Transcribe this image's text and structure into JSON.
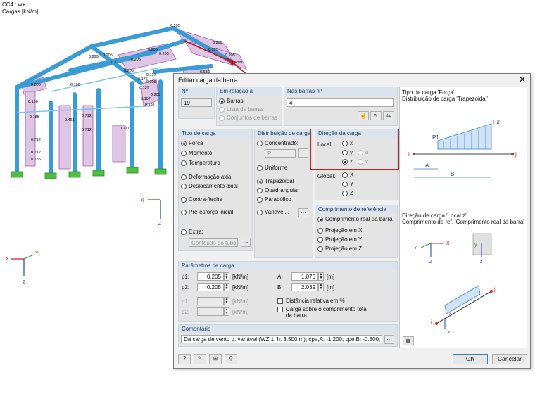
{
  "viewport": {
    "load_case": "CC4 : w+",
    "units_label": "Cargas [kN/m]",
    "load_values": [
      "0.205",
      "0.205",
      "0.205",
      "0.205",
      "0.299",
      "0.205",
      "0.205",
      "0.205",
      "0.137",
      "0.205",
      "0.137",
      "0.171",
      "0.176",
      "0.205",
      "0.107",
      "0.277",
      "0.712",
      "0.712",
      "0.185",
      "0.190",
      "0.461",
      "0.712",
      "0.712",
      "0.185",
      "0.190",
      "0.800",
      "0.299",
      "0.205",
      "0.205",
      "0.630",
      "0.137"
    ],
    "axes_main": {
      "x": "X",
      "z": "Z"
    },
    "axes_corner": {
      "x": "X",
      "y": "Y",
      "z": "Z"
    }
  },
  "dialog": {
    "title": "Editar carga da barra",
    "no": {
      "header": "Nº",
      "value": "19"
    },
    "em_relacao": {
      "header": "Em relação a",
      "options": [
        "Barras",
        "Lista de barras",
        "Conjuntos de barras"
      ]
    },
    "nas_barras": {
      "header": "Nas barras nº",
      "value": "4"
    },
    "tipo_carga": {
      "header": "Tipo de carga",
      "options": [
        "Força",
        "Momento",
        "Temperatura",
        "Deformação axial",
        "Deslocamento axial",
        "Contra-flecha",
        "Pré-esforço inicial",
        "Extra:"
      ],
      "extra_value": "Conteúdo do tubo"
    },
    "distribuicao": {
      "header": "Distribuição de carga",
      "options": [
        "Concentrado:",
        "Uniforme",
        "Trapezoidal",
        "Quadrangular",
        "Parabólico",
        "Variável..."
      ],
      "concentrado_value": "P"
    },
    "direcao": {
      "header": "Direção da carga",
      "local_label": "Local:",
      "global_label": "Global:",
      "local": [
        "x",
        "y",
        "z"
      ],
      "local_alt": [
        "u",
        "v"
      ],
      "global": [
        "X",
        "Y",
        "Z"
      ]
    },
    "comprimento": {
      "header": "Comprimento de referência",
      "options": [
        "Comprimento real da barra",
        "Projeção em X",
        "Projeção em Y",
        "Projeção em Z"
      ]
    },
    "parametros": {
      "header": "Parâmetros de carga",
      "p1": {
        "label": "p1:",
        "value": "0.205",
        "unit": "[kN/m]"
      },
      "p2": {
        "label": "p2:",
        "value": "0.205",
        "unit": "[kN/m]"
      },
      "a": {
        "label": "A:",
        "value": "1.076",
        "unit": "[m]"
      },
      "b": {
        "label": "B:",
        "value": "2.039",
        "unit": "[m]"
      },
      "p3": {
        "label": "p1:",
        "unit": "[kN/m]"
      },
      "p4": {
        "label": "p2:",
        "unit": "[kN/m]"
      },
      "dist_rel": "Distância relativa em %",
      "carga_total": "Carga sobre o comprimento total da barra"
    },
    "comentario": {
      "header": "Comentário",
      "value": "Da carga de vento q: variável (WZ 1, h: 3.500 m); cpe,A: -1.200; cpe,B: -0.800; cpe,C: -0.50"
    },
    "info": {
      "line1": "Tipo de carga 'Força'",
      "line2": "Distribuição de carga 'Trapezoidal'",
      "p1": "P1",
      "p2": "P2",
      "i": "i",
      "j": "j",
      "a": "A",
      "b": "B",
      "line3": "Direção de carga 'Local z'",
      "line4": "Comprimento de ref. 'Comprimento real da barra'",
      "axes": {
        "x": "X",
        "y": "Y",
        "z": "Z",
        "lx": "x",
        "ly": "y",
        "lz": "z"
      }
    },
    "buttons": {
      "ok": "OK",
      "cancel": "Cancelar"
    },
    "colors": {
      "accent": "#c31e22",
      "header_text": "#1b3c6b",
      "load_fill": "#d9b9df",
      "steel": "#3a9bd6"
    }
  }
}
